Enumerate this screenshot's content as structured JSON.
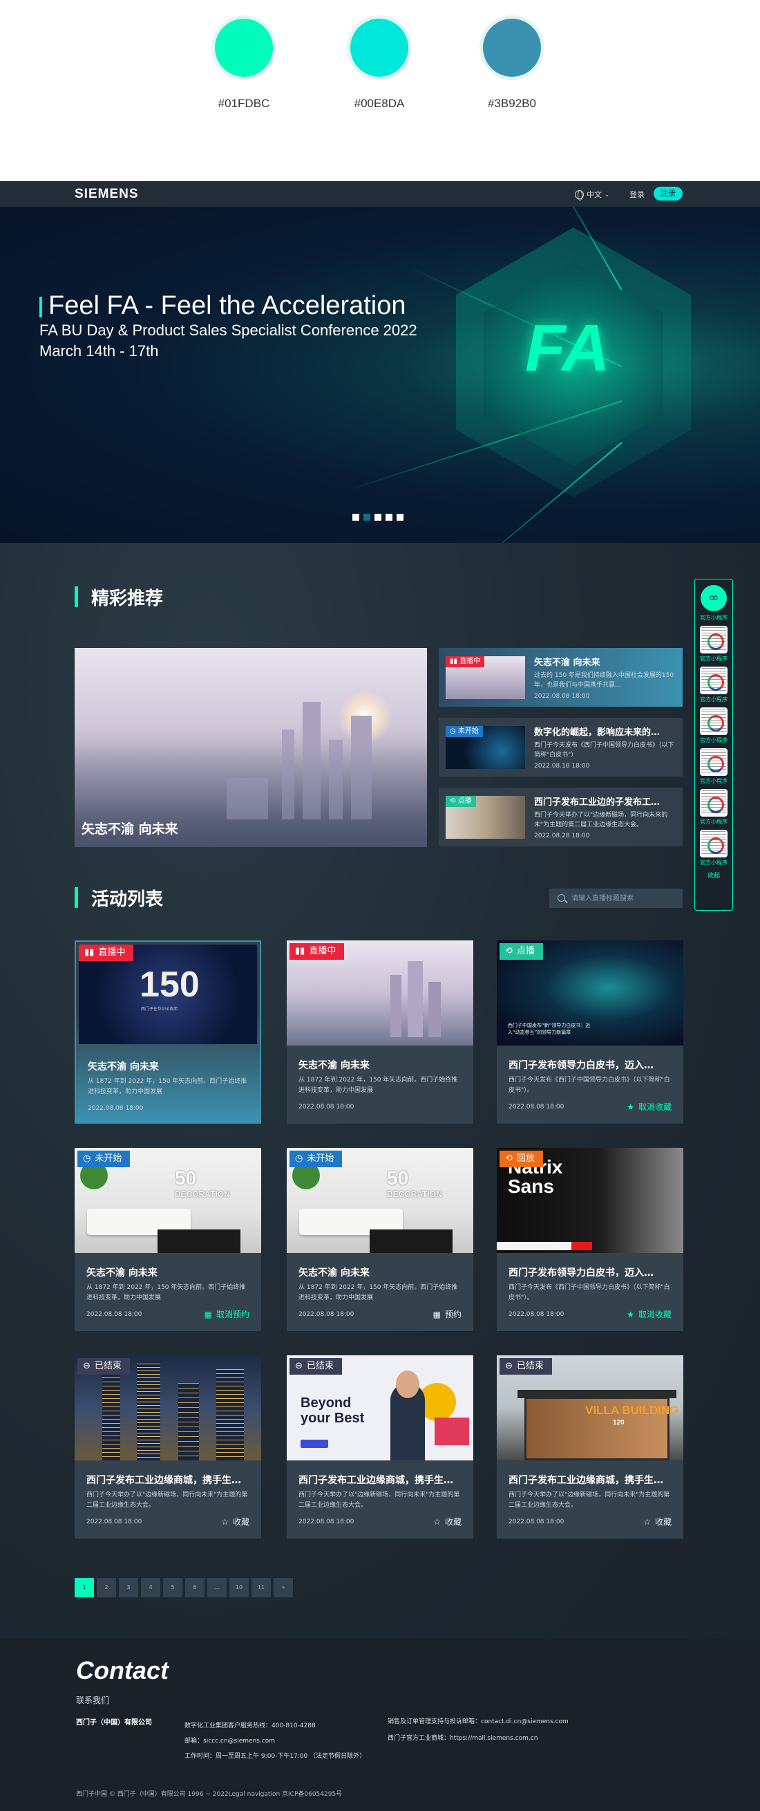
{
  "swatches": [
    {
      "hex": "#01FDBC",
      "color": "#01FDBC"
    },
    {
      "hex": "#00E8DA",
      "color": "#00E8DA"
    },
    {
      "hex": "#3B92B0",
      "color": "#3B92B0"
    }
  ],
  "header": {
    "logo": "SIEMENS",
    "language": "中文",
    "login": "登录",
    "register": "注册"
  },
  "banner": {
    "title": "Feel FA - Feel the Acceleration",
    "subtitle": "FA BU Day & Product Sales Specialist Conference 2022",
    "date": "March 14th - 17th",
    "logo_text": "FA",
    "slides": 5,
    "active_slide": 2
  },
  "featured": {
    "section_title": "精彩推荐",
    "main_caption": "矢志不渝 向未来",
    "side_items": [
      {
        "badge": "直播中",
        "badge_color": "#e8253b",
        "title": "矢志不渝 向未来",
        "desc": "过去的 150 年是我们持续融入中国社会发展的150年，也是我们与中国携手共赢…",
        "date": "2022.08.08 18:00"
      },
      {
        "badge": "未开始",
        "badge_color": "#1e78c8",
        "title": "数字化的崛起，影响应未来的…",
        "desc": "西门子今天发布《西门子中国领导力白皮书》（以下简称\"白皮书\"）",
        "date": "2022.08.18 18:00"
      },
      {
        "badge": "点播",
        "badge_color": "#1fc39a",
        "title": "西门子发布工业边的子发布工…",
        "desc": "西门子今天举办了以\"边缘新磁场，同行向未来的未\"为主题的第二届工业边缘生态大会。",
        "date": "2022.08.28 18:00"
      }
    ]
  },
  "floating": {
    "main_label": "官方小程序",
    "qr_labels": [
      "官方小程序",
      "官方小程序",
      "官方小程序",
      "官方小程序",
      "官方小程序",
      "官方小程序"
    ],
    "close": "收起"
  },
  "activities": {
    "section_title": "活动列表",
    "search_placeholder": "请输入直播标题搜索",
    "cards": [
      {
        "badge": "直播中",
        "badge_color": "#e8253b",
        "image_overlay": "150",
        "image_caption": "西门子在华150周年",
        "title": "矢志不渝 向未来",
        "desc": "从 1872 年到 2022 年，150 年矢志向前。西门子始终推进科技变革，助力中国发展",
        "date": "2022.08.08 18:00",
        "action": ""
      },
      {
        "badge": "直播中",
        "badge_color": "#e8253b",
        "title": "矢志不渝 向未来",
        "desc": "从 1872 年到 2022 年，150 年矢志向前。西门子始终推进科技变革，助力中国发展",
        "date": "2022.08.08 18:00",
        "action": ""
      },
      {
        "badge": "点播",
        "badge_color": "#1fc39a",
        "image_caption": "西门子中国发布“新”领导力白皮书：迈入“动态参互”的领导力新篇章",
        "title": "西门子发布领导力白皮书，迈入…",
        "desc": "西门子今天发布《西门子中国领导力白皮书》（以下简称\"白皮书\"）。",
        "date": "2022.08.08 18:00",
        "action": "取消收藏"
      },
      {
        "badge": "未开始",
        "badge_color": "#1e78c8",
        "image_overlay": "50",
        "image_caption": "DECORATION",
        "title": "矢志不渝 向未来",
        "desc": "从 1872 年到 2022 年，150 年矢志向前。西门子始终推进科技变革，助力中国发展",
        "date": "2022.08.08 18:00",
        "action": "取消预约"
      },
      {
        "badge": "未开始",
        "badge_color": "#1e78c8",
        "image_overlay": "50",
        "image_caption": "DECORATION",
        "title": "矢志不渝 向未来",
        "desc": "从 1872 年到 2022 年，150 年矢志向前。西门子始终推进科技变革，助力中国发展",
        "date": "2022.08.08 18:00",
        "action": "预约"
      },
      {
        "badge": "回放",
        "badge_color": "#ef6c1a",
        "image_overlay": "Natrix Sans",
        "title": "西门子发布领导力白皮书，迈入…",
        "desc": "西门子今天发布《西门子中国领导力白皮书》（以下简称\"白皮书\"）。",
        "date": "2022.08.08 18:00",
        "action": "取消收藏"
      },
      {
        "badge": "已结束",
        "badge_color": "#3b3f55",
        "title": "西门子发布工业边缘商城，携手生…",
        "desc": "西门子今天举办了以\"边缘新磁场，同行向未来\"为主题的第二届工业边缘生态大会。",
        "date": "2022.08.08 18:00",
        "action": "收藏"
      },
      {
        "badge": "已结束",
        "badge_color": "#3b3f55",
        "image_overlay": "Beyond your Best",
        "title": "西门子发布工业边缘商城，携手生…",
        "desc": "西门子今天举办了以\"边缘新磁场，同行向未来\"为主题的第二届工业边缘生态大会。",
        "date": "2022.08.08 18:00",
        "action": "收藏"
      },
      {
        "badge": "已结束",
        "badge_color": "#3b3f55",
        "image_overlay": "VILLA BUILDING",
        "image_caption": "120",
        "title": "西门子发布工业边缘商城，携手生…",
        "desc": "西门子今天举办了以\"边缘新磁场，同行向未来\"为主题的第二届工业边缘生态大会。",
        "date": "2022.08.08 18:00",
        "action": "收藏"
      }
    ]
  },
  "pagination": {
    "pages": [
      "1",
      "2",
      "3",
      "4",
      "5",
      "6",
      "…",
      "10",
      "11",
      "»"
    ],
    "current": "1"
  },
  "footer": {
    "contact": "Contact",
    "contact_us": "联系我们",
    "company": "西门子（中国）有限公司",
    "hotline": "数字化工业集团客户服务热线：400-810-4288",
    "email": "邮箱：siccc.cn@siemens.com",
    "hours": "工作时间：周一至周五上午 9:00-下午17:00 （法定节假日除外）",
    "sales": "销售及订单管理支持与投诉邮箱：contact.di.cn@siemens.com",
    "mall": "西门子官方工业商城：https://mall.siemens.com.cn",
    "copyright": "西门子中国 © 西门子（中国）有限公司 1996 ~ 2022Legal navigation  京ICP备06054295号"
  }
}
